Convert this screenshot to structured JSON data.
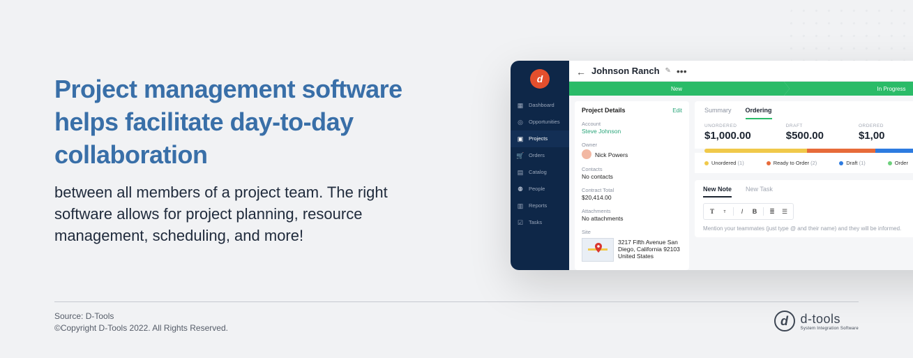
{
  "marketing": {
    "headline": "Project management software helps facilitate day-to-day collaboration",
    "subtext": "between all members of a project team. The right software allows for project planning, resource management, scheduling, and more!"
  },
  "footer": {
    "source": "Source: D-Tools",
    "copyright": "©Copyright D-Tools 2022. All Rights Reserved.",
    "brand_name": "d-tools",
    "brand_tag": "System Integration Software"
  },
  "sidebar": {
    "items": [
      {
        "label": "Dashboard",
        "icon": "▦"
      },
      {
        "label": "Opportunities",
        "icon": "◎"
      },
      {
        "label": "Projects",
        "icon": "▣"
      },
      {
        "label": "Orders",
        "icon": "🛒"
      },
      {
        "label": "Catalog",
        "icon": "▤"
      },
      {
        "label": "People",
        "icon": "⚉"
      },
      {
        "label": "Reports",
        "icon": "▥"
      },
      {
        "label": "Tasks",
        "icon": "☑"
      }
    ],
    "active_index": 2
  },
  "project": {
    "title": "Johnson Ranch",
    "progress_steps": [
      "New",
      "In Progress"
    ]
  },
  "details": {
    "panel_title": "Project Details",
    "edit_label": "Edit",
    "account_label": "Account",
    "account_value": "Steve Johnson",
    "owner_label": "Owner",
    "owner_value": "Nick Powers",
    "contacts_label": "Contacts",
    "contacts_value": "No contacts",
    "contract_label": "Contract Total",
    "contract_value": "$20,414.00",
    "attachments_label": "Attachments",
    "attachments_value": "No attachments",
    "site_label": "Site",
    "site_value": "3217 Fifth Avenue San Diego, California 92103 United States"
  },
  "ordering": {
    "tabs": [
      "Summary",
      "Ordering"
    ],
    "active_tab": 1,
    "stats": [
      {
        "label": "UNORDERED",
        "value": "$1,000.00"
      },
      {
        "label": "DRAFT",
        "value": "$500.00"
      },
      {
        "label": "ORDERED",
        "value": "$1,00"
      }
    ],
    "bar_segments": [
      {
        "color": "#f0c94a",
        "width": "36%"
      },
      {
        "color": "#e76b3a",
        "width": "24%"
      },
      {
        "color": "#2d7be0",
        "width": "24%"
      },
      {
        "color": "#6dd07c",
        "width": "16%"
      }
    ],
    "legend": [
      {
        "color": "#f0c94a",
        "label": "Unordered",
        "count": "(1)"
      },
      {
        "color": "#e76b3a",
        "label": "Ready to Order",
        "count": "(2)"
      },
      {
        "color": "#2d7be0",
        "label": "Draft",
        "count": "(1)"
      },
      {
        "color": "#6dd07c",
        "label": "Order"
      }
    ]
  },
  "notes": {
    "tabs": [
      "New Note",
      "New Task"
    ],
    "active_tab": 0,
    "placeholder": "Mention your teammates (just type @ and their name) and they will be informed."
  },
  "colors": {
    "sidebar_bg": "#0e2748",
    "brand_bg": "#e34f2d",
    "progress_green": "#2abb68",
    "link_green": "#2aa57a",
    "headline_blue": "#396fa8"
  }
}
